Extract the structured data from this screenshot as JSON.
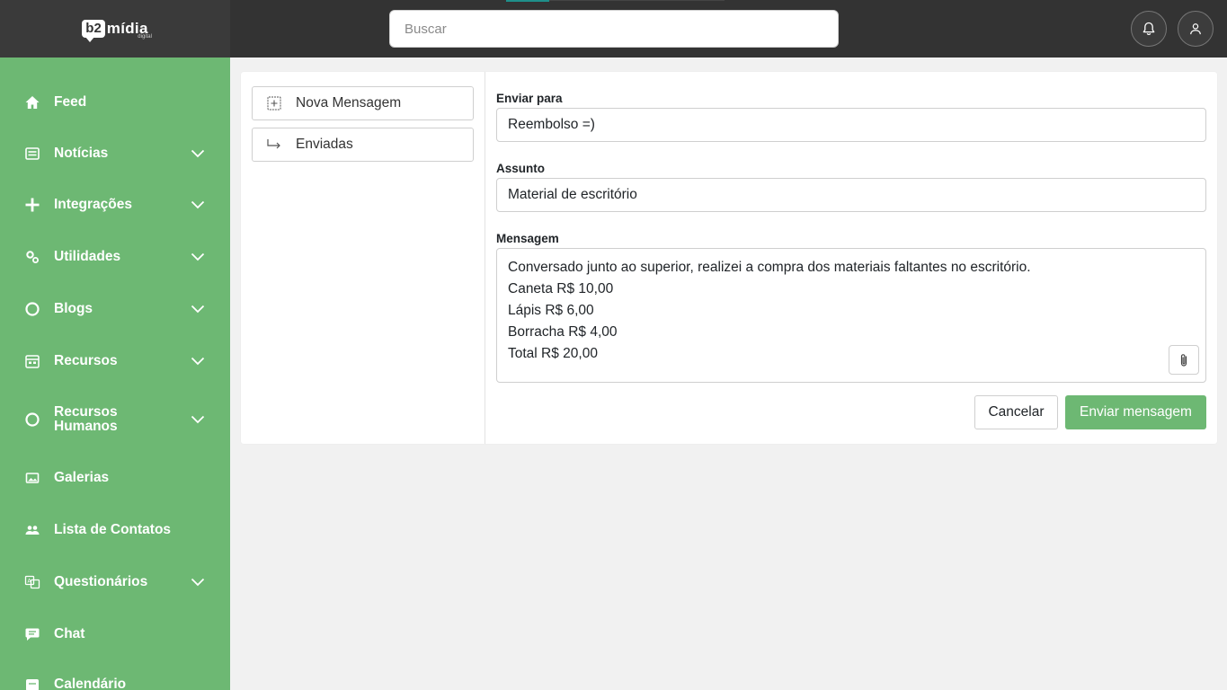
{
  "header": {
    "logo_badge": "b2",
    "logo_text": "mídia",
    "logo_sub": "digital",
    "search_placeholder": "Buscar"
  },
  "sidebar": {
    "items": [
      {
        "label": "Feed",
        "icon": "home-icon",
        "has_submenu": false
      },
      {
        "label": "Notícias",
        "icon": "newspaper-icon",
        "has_submenu": true
      },
      {
        "label": "Integrações",
        "icon": "plus-icon",
        "has_submenu": true
      },
      {
        "label": "Utilidades",
        "icon": "gears-icon",
        "has_submenu": true
      },
      {
        "label": "Blogs",
        "icon": "circle-icon",
        "has_submenu": true
      },
      {
        "label": "Recursos",
        "icon": "calendar-grid-icon",
        "has_submenu": true
      },
      {
        "label": "Recursos Humanos",
        "icon": "circle-icon",
        "has_submenu": true
      },
      {
        "label": "Galerias",
        "icon": "image-icon",
        "has_submenu": false
      },
      {
        "label": "Lista de Contatos",
        "icon": "users-icon",
        "has_submenu": false
      },
      {
        "label": "Questionários",
        "icon": "translate-icon",
        "has_submenu": true
      },
      {
        "label": "Chat",
        "icon": "chat-icon",
        "has_submenu": false
      },
      {
        "label": "Calendário",
        "icon": "calendar-icon",
        "has_submenu": false
      }
    ]
  },
  "messages": {
    "new_message_label": "Nova Mensagem",
    "sent_label": "Enviadas"
  },
  "form": {
    "to_label": "Enviar para",
    "to_value": "Reembolso =)",
    "subject_label": "Assunto",
    "subject_value": "Material de escritório",
    "message_label": "Mensagem",
    "message_lines": [
      "Conversado junto ao superior, realizei a compra dos materiais faltantes no escritório.",
      "Caneta R$ 10,00",
      "Lápis R$ 6,00",
      "Borracha R$ 4,00",
      "Total R$ 20,00"
    ],
    "cancel_label": "Cancelar",
    "send_label": "Enviar mensagem"
  },
  "colors": {
    "sidebar_bg": "#6db873",
    "topbar_bg": "#333333",
    "accent": "#6db873"
  }
}
